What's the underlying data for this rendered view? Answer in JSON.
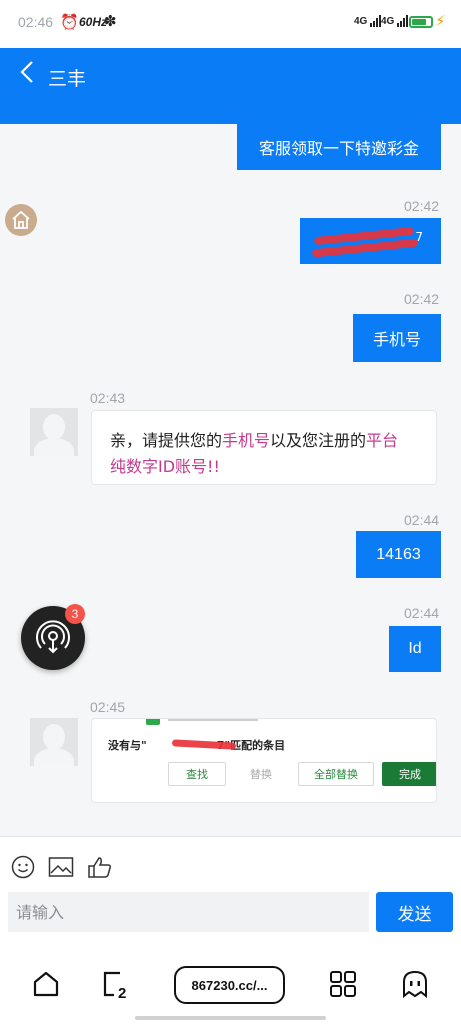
{
  "status_bar": {
    "time": "02:46",
    "refresh_rate": "60Hz",
    "signal_1": "4G",
    "signal_2": "4G"
  },
  "header": {
    "title": "三丰",
    "accent": "#0a7cf5"
  },
  "chat": {
    "top_outgoing": "客服领取一下特邀彩金",
    "messages": [
      {
        "time": "02:42",
        "text": "7"
      },
      {
        "time": "02:42",
        "text": "手机号"
      },
      {
        "time": "02:43",
        "text_prefix": "亲，请提供您的",
        "highlight_1": "手机号",
        "text_mid": "以及您注册的",
        "highlight_2": "平台",
        "line2": "纯数字ID账号!!"
      },
      {
        "time": "02:44",
        "text": "14163"
      },
      {
        "time": "02:44",
        "text": "Id"
      },
      {
        "time": "02:45"
      }
    ],
    "screenshot": {
      "no_match_prefix": "没有与\"",
      "no_match_suffix": "7\"匹配的条目",
      "find": "查找",
      "replace": "替换",
      "replace_all": "全部替换",
      "done": "完成"
    }
  },
  "float_badge": "3",
  "input": {
    "placeholder": "请输入",
    "send": "发送"
  },
  "browser": {
    "url": "867230.cc/..."
  }
}
